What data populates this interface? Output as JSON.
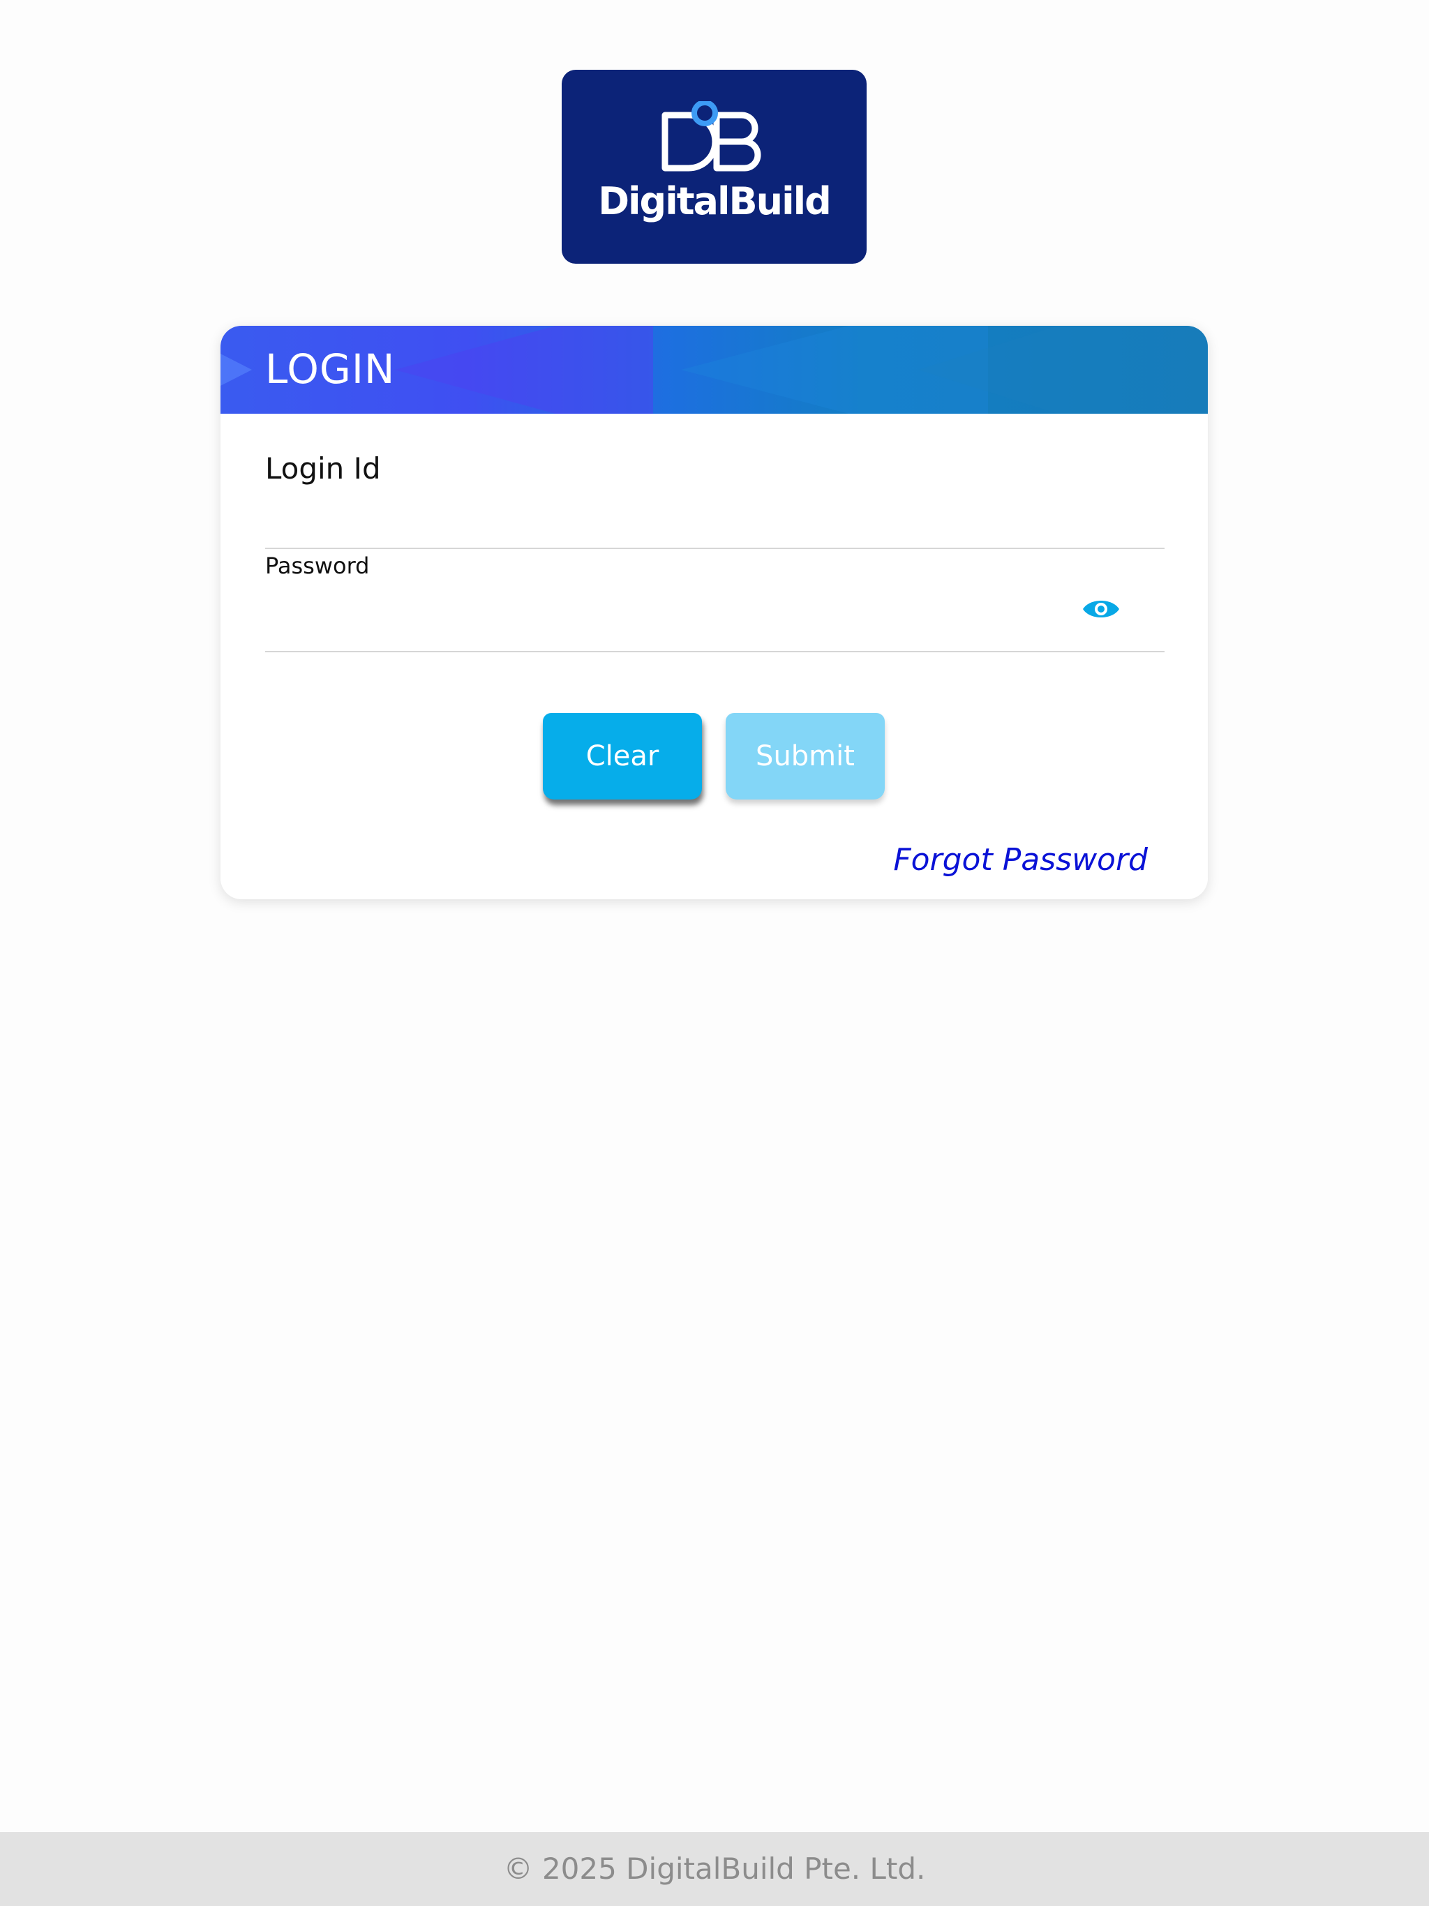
{
  "logo": {
    "wordmark": "DigitalBuild",
    "monogram": "DB",
    "background_color": "#0c2378",
    "accent_color": "#3d9bf5"
  },
  "login_card": {
    "title": "LOGIN",
    "login_id": {
      "label": "Login Id",
      "value": "",
      "placeholder": ""
    },
    "password": {
      "label": "Password",
      "value": "",
      "placeholder": "",
      "toggle_icon": "eye-icon"
    },
    "buttons": {
      "clear_label": "Clear",
      "submit_label": "Submit"
    },
    "forgot_password_label": "Forgot Password"
  },
  "colors": {
    "primary_button": "#06adea",
    "disabled_button": "#83d6f7",
    "link": "#0a12d6",
    "header_gradient_start": "#3a5bf0",
    "header_gradient_end": "#167bb9"
  },
  "footer": {
    "copyright": "© 2025 DigitalBuild Pte. Ltd."
  }
}
